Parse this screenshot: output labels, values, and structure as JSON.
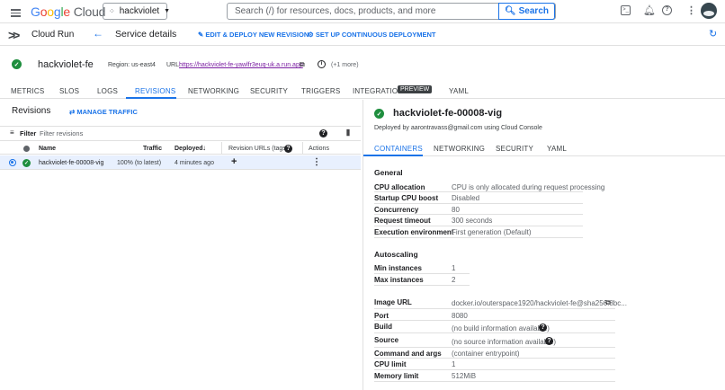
{
  "topbar": {
    "brand": "Google Cloud",
    "project": "hackviolet",
    "search_placeholder": "Search (/) for resources, docs, products, and more",
    "search_button": "Search"
  },
  "service_header": {
    "product": "Cloud Run",
    "title": "Service details",
    "edit_deploy": "EDIT & DEPLOY NEW REVISION",
    "continuous": "SET UP CONTINUOUS DEPLOYMENT"
  },
  "service": {
    "name": "hackviolet-fe",
    "region": "Region: us-east4",
    "url_label": "URL:",
    "url": "https://hackviolet-fe-yawlfr3euq-uk.a.run.app",
    "more": "(+1 more)"
  },
  "tabs": [
    "METRICS",
    "SLOS",
    "LOGS",
    "REVISIONS",
    "NETWORKING",
    "SECURITY",
    "TRIGGERS",
    "INTEGRATIONS",
    "YAML"
  ],
  "preview_badge": "PREVIEW",
  "revisions": {
    "title": "Revisions",
    "manage_traffic": "MANAGE TRAFFIC",
    "filter_label": "Filter",
    "filter_placeholder": "Filter revisions",
    "columns": [
      "Name",
      "Traffic",
      "Deployed",
      "Revision URLs (tags)",
      "Actions"
    ],
    "rows": [
      {
        "name": "hackviolet-fe-00008-vig",
        "traffic": "100% (to latest)",
        "deployed": "4 minutes ago"
      }
    ]
  },
  "detail": {
    "title": "hackviolet-fe-00008-vig",
    "deployed_by": "Deployed by aarontravass@gmail.com using Cloud Console",
    "tabs": [
      "CONTAINERS",
      "NETWORKING",
      "SECURITY",
      "YAML"
    ],
    "general_title": "General",
    "general": [
      {
        "label": "CPU allocation",
        "value": "CPU is only allocated during request processing"
      },
      {
        "label": "Startup CPU boost",
        "value": "Disabled"
      },
      {
        "label": "Concurrency",
        "value": "80"
      },
      {
        "label": "Request timeout",
        "value": "300 seconds"
      },
      {
        "label": "Execution environment",
        "value": "First generation (Default)"
      }
    ],
    "autoscaling_title": "Autoscaling",
    "autoscaling": [
      {
        "label": "Min instances",
        "value": "1"
      },
      {
        "label": "Max instances",
        "value": "2"
      }
    ],
    "container": [
      {
        "label": "Image URL",
        "value": "docker.io/outerspace1920/hackviolet-fe@sha256:8bc..."
      },
      {
        "label": "Port",
        "value": "8080"
      },
      {
        "label": "Build",
        "value": "(no build information available)"
      },
      {
        "label": "Source",
        "value": "(no source information available)"
      },
      {
        "label": "Command and args",
        "value": "(container entrypoint)"
      },
      {
        "label": "CPU limit",
        "value": "1"
      },
      {
        "label": "Memory limit",
        "value": "512MiB"
      }
    ]
  },
  "colors": {
    "accent": "#1a73e8",
    "success": "#1e8e3e"
  }
}
